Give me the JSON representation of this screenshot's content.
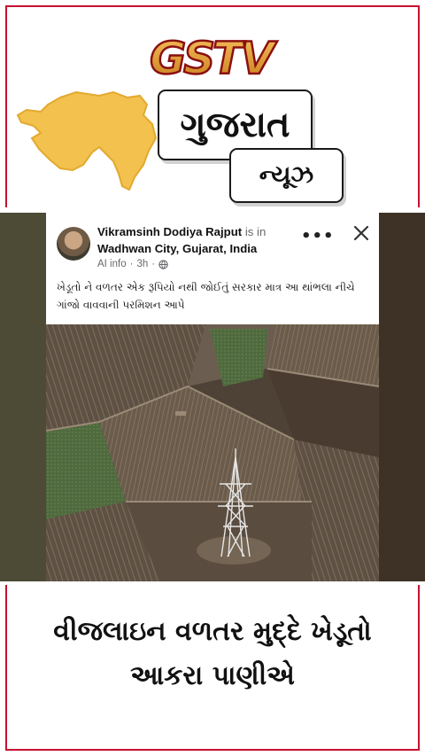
{
  "brand": {
    "logo_text": "GSTV",
    "colors": {
      "accent": "#c8102e",
      "logo_gold": "#e9a43a",
      "map": "#f2c14e"
    }
  },
  "badge": {
    "title": "ગુજરાત",
    "subtitle": "ન્યૂઝ"
  },
  "post": {
    "author_name": "Vikramsinh Dodiya Rajput",
    "is_in": "is in",
    "location": "Wadhwan City, Gujarat, India",
    "meta_label": "AI info",
    "meta_time": "3h",
    "more_icon": "more-horizontal-icon",
    "close_icon": "close-icon",
    "caption": "ખેડૂતો ને વળતર એક રૂપિયો નથી જોઈતું સરકાર માત્ર આ થાંભલા નીચે ગાંજો વાવવાની પરમિશન આપે"
  },
  "headline": {
    "line1": "વીજલાઇન વળતર મુદ્દે ખેડૂતો",
    "line2": "આકરા પાણીએ"
  }
}
